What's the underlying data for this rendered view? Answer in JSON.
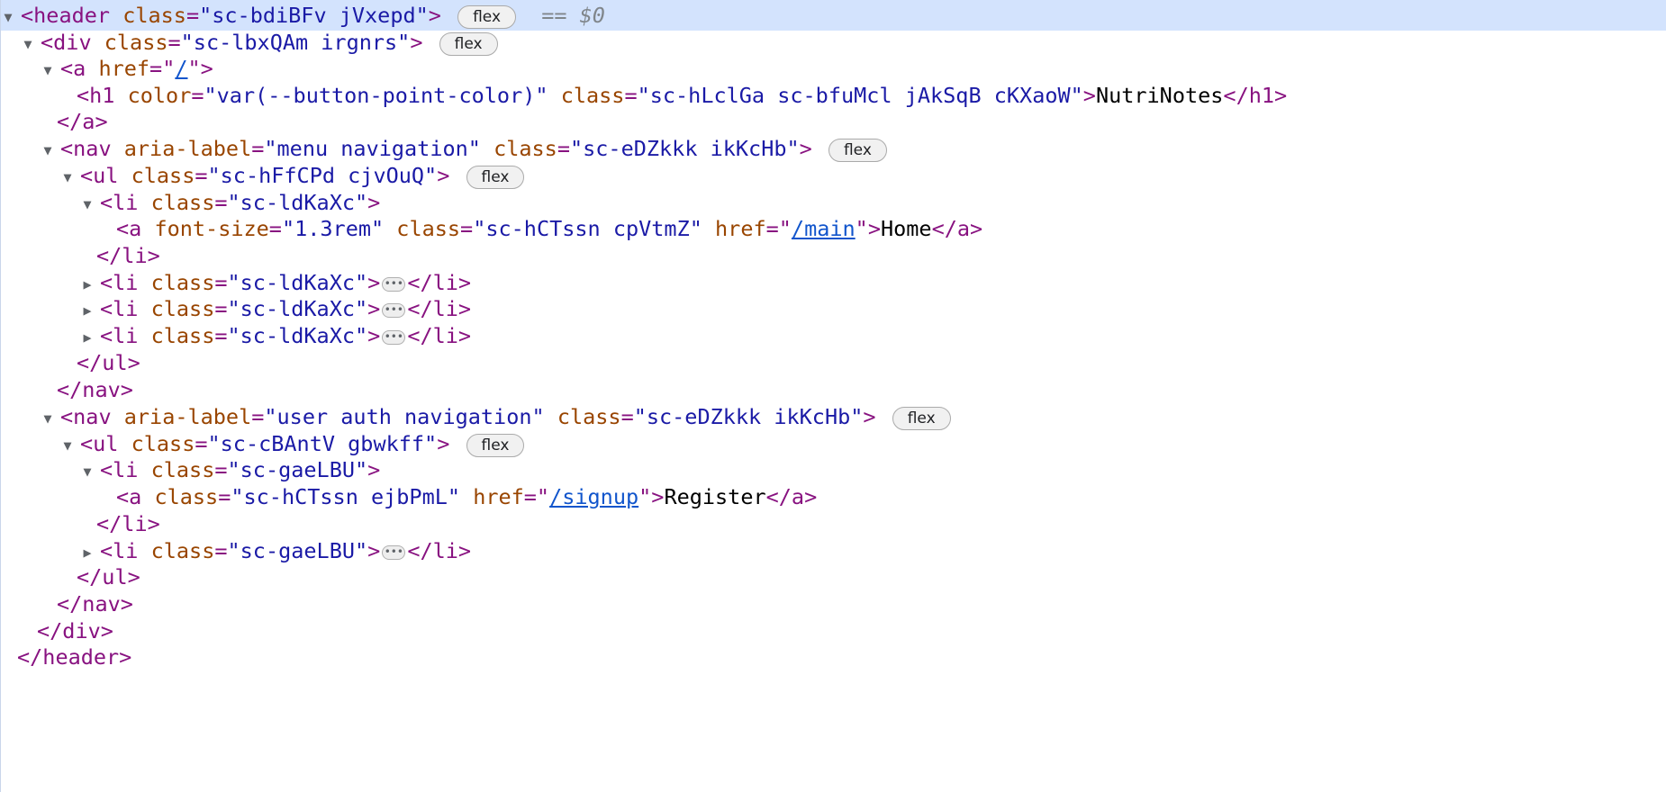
{
  "elements_panel": {
    "selected_marker": "== $0",
    "badge_flex": "flex",
    "ellipsis": "•••",
    "icons": {
      "expanded": "triangle-down-icon",
      "collapsed": "triangle-right-icon"
    },
    "colors": {
      "tag": "#881280",
      "attribute": "#994500",
      "value": "#1a1aa6",
      "link": "#1155cc",
      "selected_row": "#d3e3fd"
    },
    "lines": {
      "l1": {
        "open": "<header",
        "a1": "class",
        "v1": "\"sc-bdiBFv jVxepd\"",
        "close": ">"
      },
      "l2": {
        "open": "<div",
        "a1": "class",
        "v1": "\"sc-lbxQAm irgnrs\"",
        "close": ">"
      },
      "l3": {
        "open": "<a",
        "a1": "href",
        "q1": "=\"",
        "link": "/",
        "q2": "\"",
        "close": ">"
      },
      "l4": {
        "open": "<h1",
        "a1": "color",
        "v1": "\"var(--button-point-color)\"",
        "a2": "class",
        "v2": "\"sc-hLclGa sc-bfuMcl jAkSqB cKXaoW\"",
        "close": ">",
        "text": "NutriNotes",
        "end": "</h1>"
      },
      "l5": {
        "end": "</a>"
      },
      "l6": {
        "open": "<nav",
        "a1": "aria-label",
        "v1": "\"menu navigation\"",
        "a2": "class",
        "v2": "\"sc-eDZkkk ikKcHb\"",
        "close": ">"
      },
      "l7": {
        "open": "<ul",
        "a1": "class",
        "v1": "\"sc-hFfCPd cjvOuQ\"",
        "close": ">"
      },
      "l8": {
        "open": "<li",
        "a1": "class",
        "v1": "\"sc-ldKaXc\"",
        "close": ">"
      },
      "l9": {
        "open": "<a",
        "a1": "font-size",
        "v1": "\"1.3rem\"",
        "a2": "class",
        "v2": "\"sc-hCTssn cpVtmZ\"",
        "a3": "href",
        "q1": "=\"",
        "link": "/main",
        "q2": "\"",
        "close": ">",
        "text": "Home",
        "end": "</a>"
      },
      "l10": {
        "end": "</li>"
      },
      "l11": {
        "open": "<li",
        "a1": "class",
        "v1": "\"sc-ldKaXc\"",
        "close": ">",
        "end": "</li>"
      },
      "l12": {
        "open": "<li",
        "a1": "class",
        "v1": "\"sc-ldKaXc\"",
        "close": ">",
        "end": "</li>"
      },
      "l13": {
        "open": "<li",
        "a1": "class",
        "v1": "\"sc-ldKaXc\"",
        "close": ">",
        "end": "</li>"
      },
      "l14": {
        "end": "</ul>"
      },
      "l15": {
        "end": "</nav>"
      },
      "l16": {
        "open": "<nav",
        "a1": "aria-label",
        "v1": "\"user auth navigation\"",
        "a2": "class",
        "v2": "\"sc-eDZkkk ikKcHb\"",
        "close": ">"
      },
      "l17": {
        "open": "<ul",
        "a1": "class",
        "v1": "\"sc-cBAntV gbwkff\"",
        "close": ">"
      },
      "l18": {
        "open": "<li",
        "a1": "class",
        "v1": "\"sc-gaeLBU\"",
        "close": ">"
      },
      "l19": {
        "open": "<a",
        "a1": "class",
        "v1": "\"sc-hCTssn ejbPmL\"",
        "a2": "href",
        "q1": "=\"",
        "link": "/signup",
        "q2": "\"",
        "close": ">",
        "text": "Register",
        "end": "</a>"
      },
      "l20": {
        "end": "</li>"
      },
      "l21": {
        "open": "<li",
        "a1": "class",
        "v1": "\"sc-gaeLBU\"",
        "close": ">",
        "end": "</li>"
      },
      "l22": {
        "end": "</ul>"
      },
      "l23": {
        "end": "</nav>"
      },
      "l24": {
        "end": "</div>"
      },
      "l25": {
        "end": "</header>"
      }
    }
  }
}
